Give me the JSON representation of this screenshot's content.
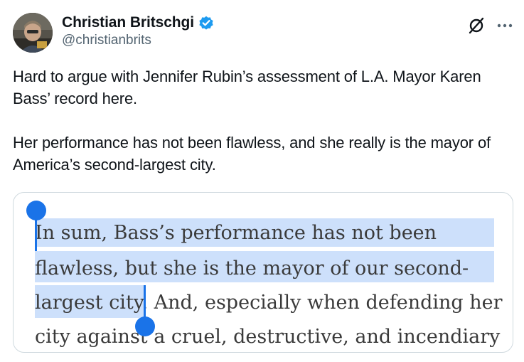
{
  "author": {
    "display_name": "Christian Britschgi",
    "handle": "@christianbrits",
    "verified": true,
    "verified_color": "#1d9bf0"
  },
  "header_actions": {
    "grok_icon": "grok-slash-circle-icon",
    "more_icon": "more-horizontal-icon"
  },
  "tweet": {
    "paragraphs": [
      "Hard to argue with Jennifer Rubin’s assessment of L.A. Mayor Karen Bass’ record here.",
      "Her performance has not been flawless, and she really is the mayor of America’s second-largest city."
    ]
  },
  "quote_image": {
    "lines": [
      "In sum, Bass’s performance has not been",
      "flawless, but she is the mayor of our second-",
      "largest city. And, especially when defending her",
      "city against a cruel, destructive, and incendiary"
    ],
    "highlight_color": "#cde0fb",
    "selection_color": "#1a73e8"
  }
}
